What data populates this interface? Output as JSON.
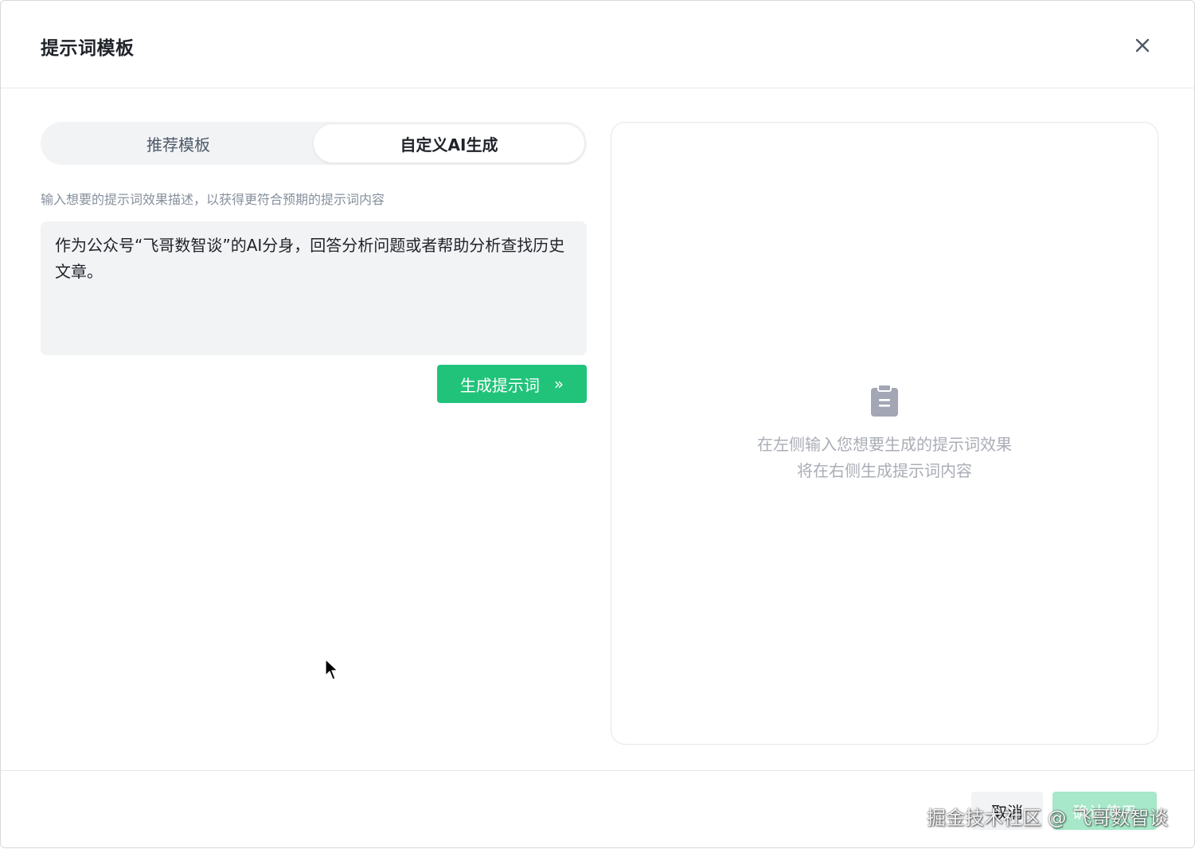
{
  "dialog": {
    "title": "提示词模板",
    "close_icon": "close-icon"
  },
  "tabs": [
    {
      "label": "推荐模板",
      "active": false
    },
    {
      "label": "自定义AI生成",
      "active": true
    }
  ],
  "form": {
    "hint": "输入想要的提示词效果描述，以获得更符合预期的提示词内容",
    "description_value": "作为公众号“飞哥数智谈”的AI分身，回答分析问题或者帮助分析查找历史文章。",
    "generate_label": "生成提示词",
    "generate_icon": "double-chevron-right-icon"
  },
  "preview": {
    "icon": "clipboard-icon",
    "empty_line_1": "在左侧输入您想要生成的提示词效果",
    "empty_line_2": "将在右侧生成提示词内容"
  },
  "footer": {
    "cancel_label": "取消",
    "confirm_label": "确认使用"
  },
  "watermark": "掘金技术社区 @ 飞哥数智谈",
  "colors": {
    "accent": "#21c37a",
    "accent_disabled": "#a6e8c9"
  }
}
